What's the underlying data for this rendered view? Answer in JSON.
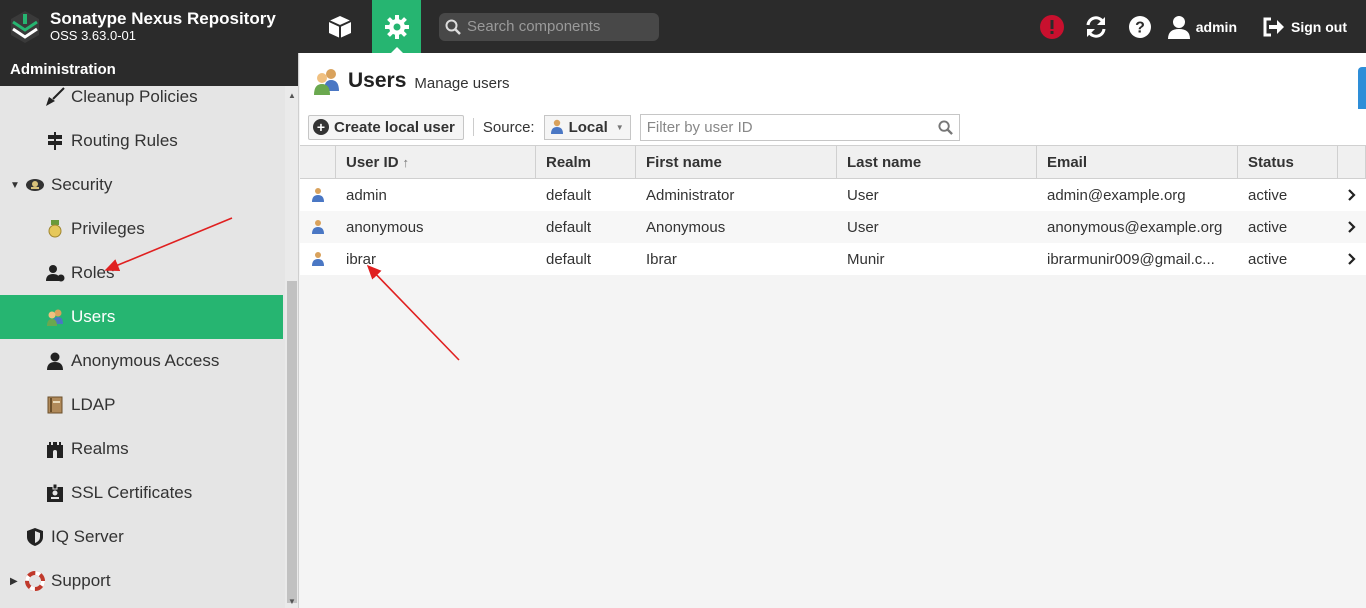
{
  "header": {
    "product_name": "Sonatype Nexus Repository",
    "version": "OSS 3.63.0-01",
    "search_placeholder": "Search components",
    "user": "admin",
    "signout": "Sign out"
  },
  "sidebar": {
    "title": "Administration",
    "items": [
      {
        "label": "Cleanup Policies",
        "icon": "broom-icon"
      },
      {
        "label": "Routing Rules",
        "icon": "signpost-icon"
      },
      {
        "label": "Security",
        "icon": "security-badge-icon",
        "expanded": true
      },
      {
        "label": "Privileges",
        "icon": "medal-icon"
      },
      {
        "label": "Roles",
        "icon": "user-role-icon"
      },
      {
        "label": "Users",
        "icon": "users-icon",
        "active": true
      },
      {
        "label": "Anonymous Access",
        "icon": "user-icon"
      },
      {
        "label": "LDAP",
        "icon": "book-icon"
      },
      {
        "label": "Realms",
        "icon": "castle-icon"
      },
      {
        "label": "SSL Certificates",
        "icon": "id-badge-icon"
      },
      {
        "label": "IQ Server",
        "icon": "shield-icon"
      },
      {
        "label": "Support",
        "icon": "lifebuoy-icon",
        "expanded": false
      }
    ]
  },
  "page": {
    "title": "Users",
    "subtitle": "Manage users"
  },
  "toolbar": {
    "create_label": "Create local user",
    "source_label": "Source:",
    "source_value": "Local",
    "filter_placeholder": "Filter by user ID"
  },
  "table": {
    "columns": [
      "User ID",
      "Realm",
      "First name",
      "Last name",
      "Email",
      "Status"
    ],
    "rows": [
      {
        "user_id": "admin",
        "realm": "default",
        "first": "Administrator",
        "last": "User",
        "email": "admin@example.org",
        "status": "active"
      },
      {
        "user_id": "anonymous",
        "realm": "default",
        "first": "Anonymous",
        "last": "User",
        "email": "anonymous@example.org",
        "status": "active"
      },
      {
        "user_id": "ibrar",
        "realm": "default",
        "first": "Ibrar",
        "last": "Munir",
        "email": "ibrarmunir009@gmail.c...",
        "status": "active"
      }
    ]
  },
  "colors": {
    "header_bg": "#2b2b2b",
    "accent_green": "#26b571",
    "alert_red": "#c8102e",
    "annotation_red": "#e02020"
  }
}
